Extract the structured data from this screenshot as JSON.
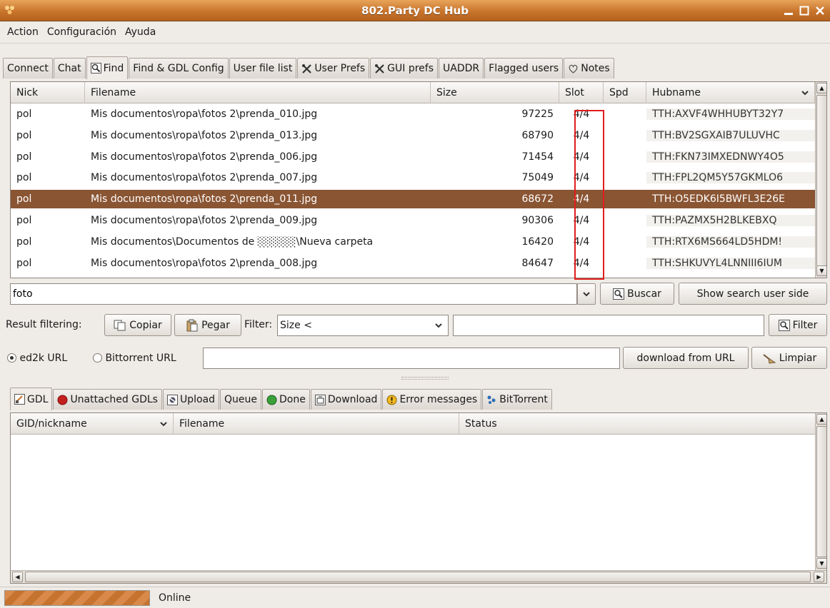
{
  "window": {
    "title": "802.Party DC Hub"
  },
  "menu": [
    "Action",
    "Configuración",
    "Ayuda"
  ],
  "top_tabs": [
    {
      "label": "Connect",
      "icon": ""
    },
    {
      "label": "Chat",
      "icon": ""
    },
    {
      "label": "Find",
      "icon": "search-icon",
      "active": true
    },
    {
      "label": "Find & GDL Config",
      "icon": ""
    },
    {
      "label": "User file list",
      "icon": ""
    },
    {
      "label": "User Prefs",
      "icon": "tools-icon"
    },
    {
      "label": "GUI prefs",
      "icon": "tools-icon"
    },
    {
      "label": "UADDR",
      "icon": ""
    },
    {
      "label": "Flagged users",
      "icon": ""
    },
    {
      "label": "Notes",
      "icon": "notes-icon"
    }
  ],
  "results": {
    "columns": [
      "Nick",
      "Filename",
      "Size",
      "Slot",
      "Spd",
      "Hubname"
    ],
    "rows": [
      {
        "nick": "pol",
        "filename": "Mis documentos\\ropa\\fotos 2\\prenda_010.jpg",
        "size": "97225",
        "slot": "4/4",
        "spd": "",
        "hub": "TTH:AXVF4WHHUBYT32Y7"
      },
      {
        "nick": "pol",
        "filename": "Mis documentos\\ropa\\fotos 2\\prenda_013.jpg",
        "size": "68790",
        "slot": "4/4",
        "spd": "",
        "hub": "TTH:BV2SGXAIB7ULUVHC"
      },
      {
        "nick": "pol",
        "filename": "Mis documentos\\ropa\\fotos 2\\prenda_006.jpg",
        "size": "71454",
        "slot": "4/4",
        "spd": "",
        "hub": "TTH:FKN73IMXEDNWY4O5"
      },
      {
        "nick": "pol",
        "filename": "Mis documentos\\ropa\\fotos 2\\prenda_007.jpg",
        "size": "75049",
        "slot": "4/4",
        "spd": "",
        "hub": "TTH:FPL2QM5Y57GKMLO6"
      },
      {
        "nick": "pol",
        "filename": "Mis documentos\\ropa\\fotos 2\\prenda_011.jpg",
        "size": "68672",
        "slot": "4/4",
        "spd": "",
        "hub": "TTH:O5EDK6I5BWFL3E26E",
        "selected": true
      },
      {
        "nick": "pol",
        "filename": "Mis documentos\\ropa\\fotos 2\\prenda_009.jpg",
        "size": "90306",
        "slot": "4/4",
        "spd": "",
        "hub": "TTH:PAZMX5H2BLKEBXQ"
      },
      {
        "nick": "pol",
        "filename": "Mis documentos\\Documentos de ░░░░░\\Nueva carpeta",
        "size": "16420",
        "slot": "4/4",
        "spd": "",
        "hub": "TTH:RTX6MS664LD5HDM!"
      },
      {
        "nick": "pol",
        "filename": "Mis documentos\\ropa\\fotos 2\\prenda_008.jpg",
        "size": "84647",
        "slot": "4/4",
        "spd": "",
        "hub": "TTH:SHKUVYL4LNNIII6IUM"
      }
    ]
  },
  "search": {
    "value": "foto",
    "buscar_label": "Buscar",
    "show_side_label": "Show search user side"
  },
  "filtering": {
    "label": "Result filtering:",
    "copiar": "Copiar",
    "pegar": "Pegar",
    "filter_label": "Filter:",
    "filter_combo": "Size <",
    "filter_value": "",
    "filter_button": "Filter"
  },
  "url": {
    "ed2k": "ed2k URL",
    "bittorrent": "Bittorrent URL",
    "value": "",
    "download": "download from URL",
    "limpiar": "Limpiar"
  },
  "bottom_tabs": [
    {
      "label": "GDL",
      "icon": "gdl-icon",
      "active": true
    },
    {
      "label": "Unattached GDLs",
      "icon": "red-circle-icon"
    },
    {
      "label": "Upload",
      "icon": "upload-icon"
    },
    {
      "label": "Queue",
      "icon": ""
    },
    {
      "label": "Done",
      "icon": "green-circle-icon"
    },
    {
      "label": "Download",
      "icon": "download-icon"
    },
    {
      "label": "Error messages",
      "icon": "warning-icon"
    },
    {
      "label": "BitTorrent",
      "icon": "bittorrent-icon"
    }
  ],
  "gdl": {
    "columns": [
      "GID/nickname",
      "Filename",
      "Status"
    ]
  },
  "status": {
    "text": "Online"
  },
  "colors": {
    "selection": "#8a5533",
    "titlebar": "#c8742c",
    "highlight_box": "#e21c1c"
  }
}
